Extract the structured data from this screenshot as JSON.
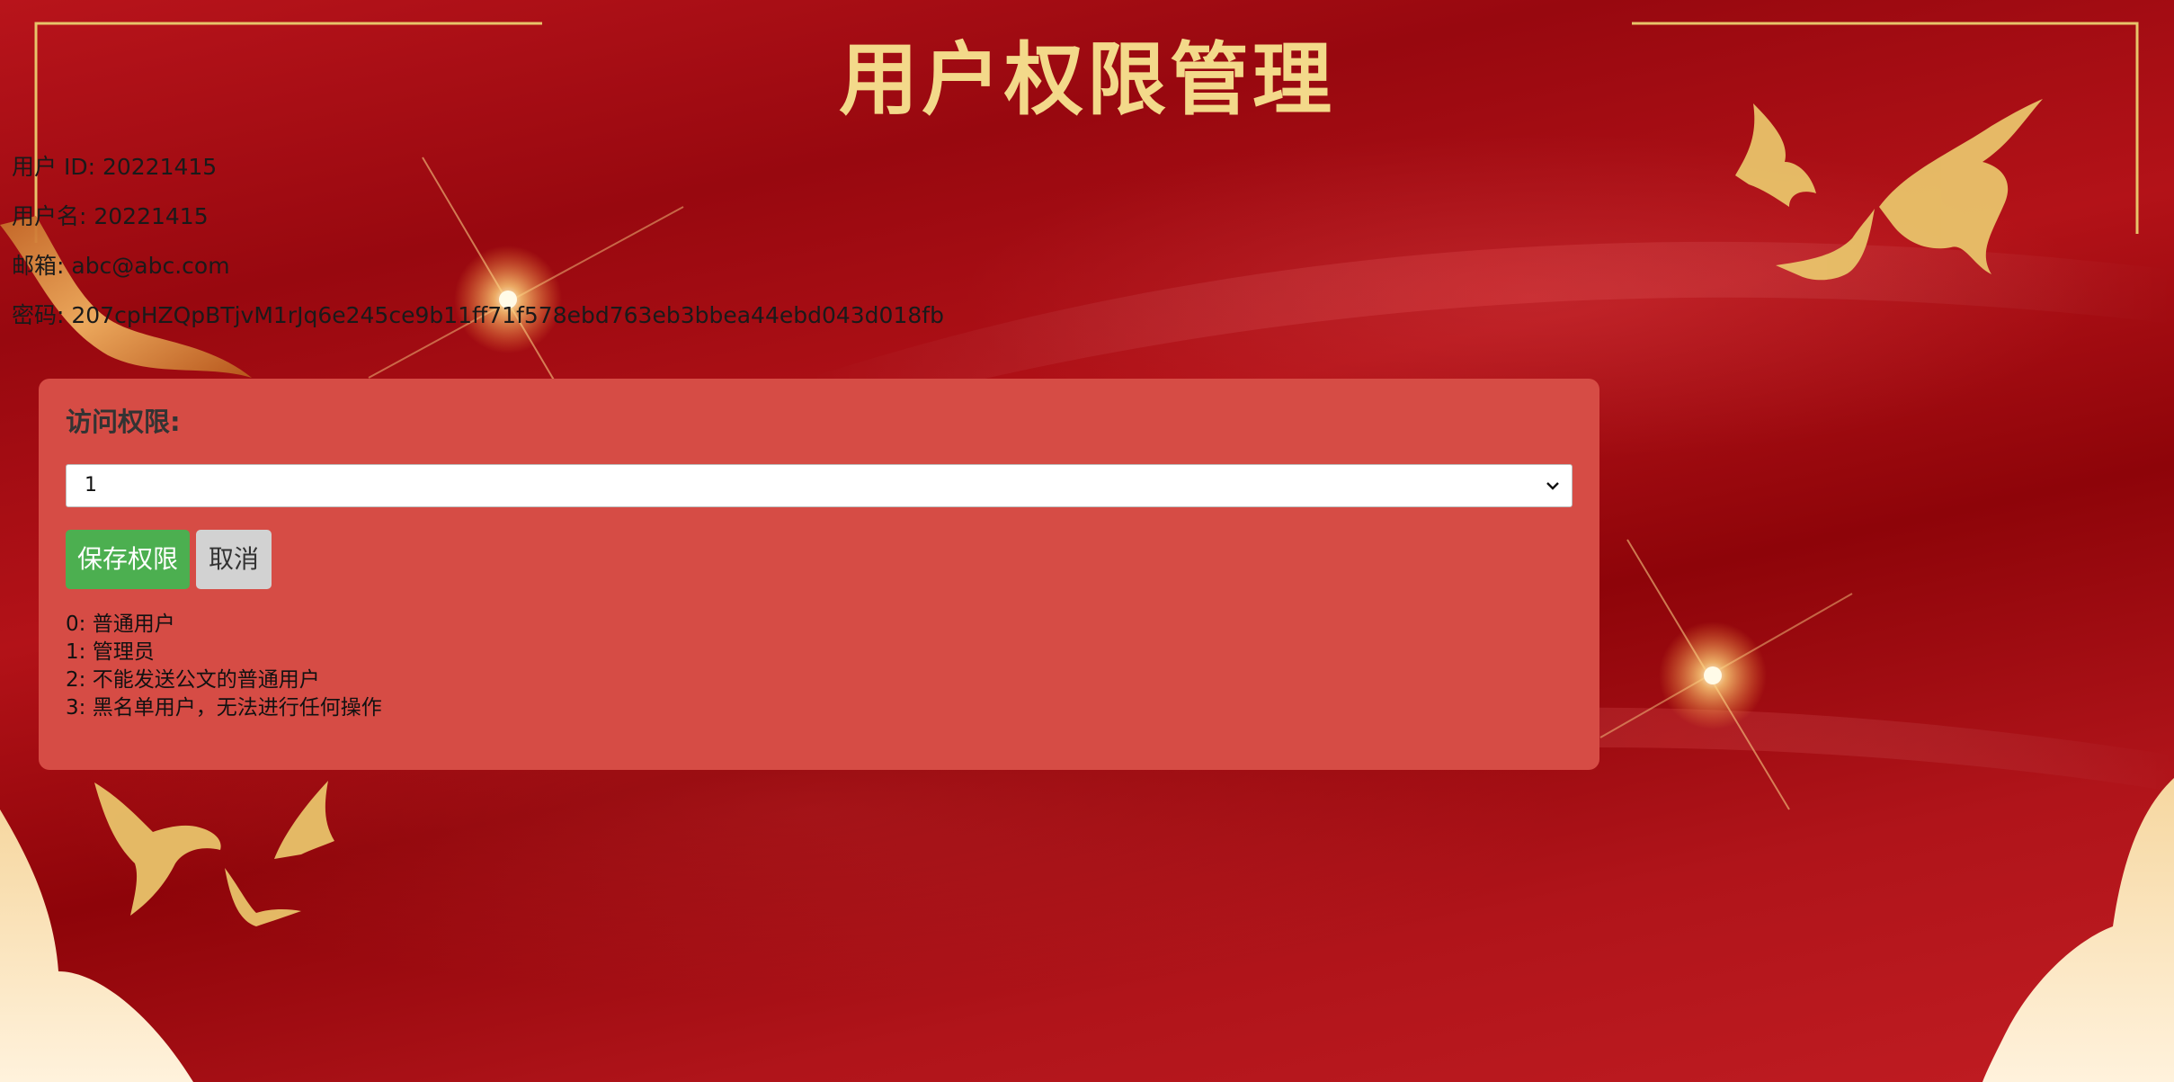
{
  "page": {
    "title": "用户权限管理"
  },
  "user_info": {
    "id_line": "用户 ID: 20221415",
    "username_line": "用户名: 20221415",
    "email_line": "邮箱: abc@abc.com",
    "password_line": "密码: 207cpHZQpBTjvM1rJq6e245ce9b11ff71f578ebd763eb3bbea44ebd043d018fb"
  },
  "permission_panel": {
    "label": "访问权限:",
    "select_value": "1",
    "save_label": "保存权限",
    "cancel_label": "取消",
    "legend": [
      "0: 普通用户",
      "1: 管理员",
      "2: 不能发送公文的普通用户",
      "3: 黑名单用户，无法进行任何操作"
    ]
  },
  "colors": {
    "background_red": "#a50d14",
    "title_gold": "#f3d98a",
    "panel": "#d64c45",
    "save_button": "#4caf50",
    "cancel_button": "#d2d2d2"
  }
}
